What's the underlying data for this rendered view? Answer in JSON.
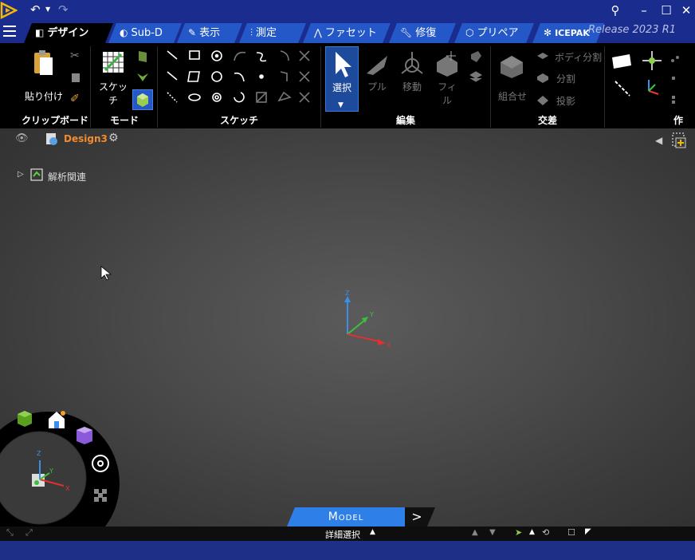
{
  "titlebar": {
    "undo_icon": "undo-icon",
    "redo_icon": "redo-icon",
    "buttons": [
      "pin",
      "minimize",
      "maximize",
      "close"
    ]
  },
  "tabs": [
    {
      "label": "デザイン",
      "active": true
    },
    {
      "label": "Sub-D"
    },
    {
      "label": "表示"
    },
    {
      "label": "測定"
    },
    {
      "label": "ファセット"
    },
    {
      "label": "修復"
    },
    {
      "label": "プリペア"
    },
    {
      "label": "ICEPAK"
    }
  ],
  "release": "Release 2023 R1",
  "ribbon": {
    "clipboard": {
      "paste_label": "貼り付け",
      "group": "クリップボード"
    },
    "mode": {
      "sketch_label": "スケッチ",
      "group": "モード"
    },
    "sketch": {
      "group": "スケッチ"
    },
    "edit": {
      "select_label": "選択",
      "pull_label": "プル",
      "move_label": "移動",
      "fill_label": "フィル",
      "group": "編集"
    },
    "intersect": {
      "combine_label": "組合せ",
      "split_body_label": "ボディ分割",
      "split_label": "分割",
      "project_label": "投影",
      "group": "交差"
    },
    "create": {
      "group": "作"
    }
  },
  "tree": {
    "design_name": "Design3",
    "item": "解析関連"
  },
  "bottom": {
    "model_tab": "Model",
    "detail_select": "詳細選択"
  },
  "colors": {
    "accent": "#2458c9",
    "titlebar": "#1a2d8f",
    "model_tab": "#2f7fe8",
    "design_name": "#f28b30"
  }
}
